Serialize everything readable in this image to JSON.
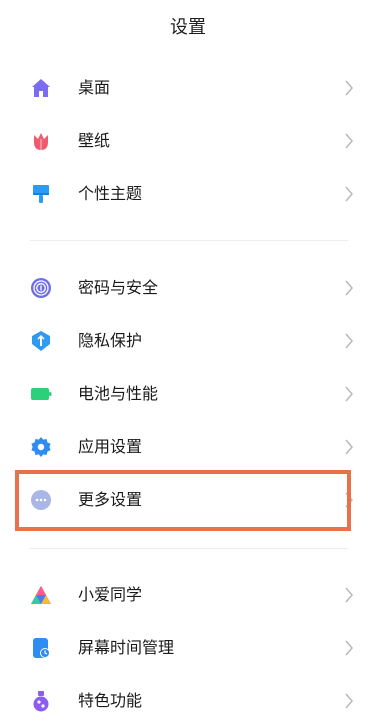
{
  "header": {
    "title": "设置"
  },
  "groups": [
    {
      "items": [
        {
          "label": "桌面",
          "icon": "home-icon",
          "color": "#7b6cf0"
        },
        {
          "label": "壁纸",
          "icon": "tulip-icon",
          "color": "#ef5b6e"
        },
        {
          "label": "个性主题",
          "icon": "paintbrush-icon",
          "color": "#2f9bf0"
        }
      ]
    },
    {
      "items": [
        {
          "label": "密码与安全",
          "icon": "fingerprint-icon",
          "color": "#6d6ee8"
        },
        {
          "label": "隐私保护",
          "icon": "privacy-shield-icon",
          "color": "#2f9bf0"
        },
        {
          "label": "电池与性能",
          "icon": "battery-icon",
          "color": "#2bd07a"
        },
        {
          "label": "应用设置",
          "icon": "gear-icon",
          "color": "#2f8cf0"
        },
        {
          "label": "更多设置",
          "icon": "more-dots-icon",
          "color": "#a9b7e6"
        }
      ]
    },
    {
      "items": [
        {
          "label": "小爱同学",
          "icon": "xiaoai-icon",
          "color": "#4a7cf0"
        },
        {
          "label": "屏幕时间管理",
          "icon": "screen-time-icon",
          "color": "#2f8cf0"
        },
        {
          "label": "特色功能",
          "icon": "feature-flask-icon",
          "color": "#8c5cf0"
        }
      ]
    }
  ],
  "highlight": {
    "target": "更多设置",
    "color": "#e8704a"
  }
}
